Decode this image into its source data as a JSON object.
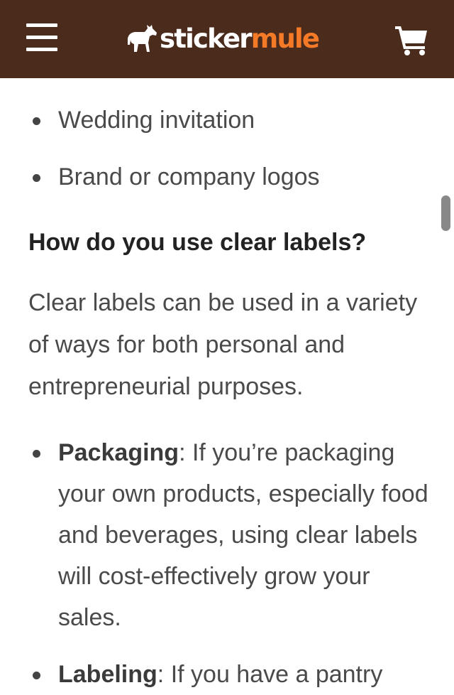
{
  "header": {
    "logo": {
      "part1": "sticker",
      "part2": "mule"
    },
    "menu_icon": "hamburger-menu-icon",
    "cart_icon": "shopping-cart-icon",
    "logo_icon": "mule-icon",
    "colors": {
      "background": "#4b2b1c",
      "logo_white": "#ffffff",
      "logo_orange": "#f47a28"
    }
  },
  "content": {
    "top_list": [
      {
        "text": "Wedding invitation"
      },
      {
        "text": "Brand or company logos"
      }
    ],
    "heading": "How do you use clear labels?",
    "paragraph": "Clear labels can be used in a variety of ways for both personal and entrepreneurial purposes.",
    "bottom_list": [
      {
        "term": "Packaging",
        "text": ": If you’re packaging your own products, especially food and beverages, using clear labels will cost-effectively grow your sales."
      },
      {
        "term": "Labeling",
        "text": ": If you have a pantry"
      }
    ]
  }
}
